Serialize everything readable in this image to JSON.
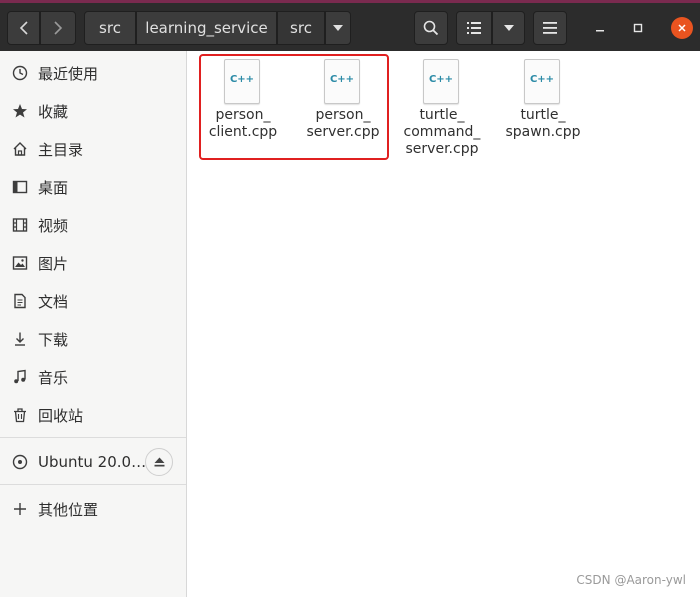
{
  "toolbar": {
    "back_icon": "chevron-left",
    "forward_icon": "chevron-right",
    "breadcrumbs": [
      "src",
      "learning_service",
      "src"
    ],
    "search_icon": "search",
    "view_icon": "list-view",
    "menu_icon": "hamburger"
  },
  "sidebar": {
    "items": [
      {
        "label": "最近使用",
        "icon": "clock"
      },
      {
        "label": "收藏",
        "icon": "star"
      },
      {
        "label": "主目录",
        "icon": "home"
      },
      {
        "label": "桌面",
        "icon": "desktop"
      },
      {
        "label": "视频",
        "icon": "film"
      },
      {
        "label": "图片",
        "icon": "image"
      },
      {
        "label": "文档",
        "icon": "document"
      },
      {
        "label": "下载",
        "icon": "download"
      },
      {
        "label": "音乐",
        "icon": "music"
      },
      {
        "label": "回收站",
        "icon": "trash"
      }
    ],
    "drive": {
      "label": "Ubuntu 20.0…",
      "icon": "disc"
    },
    "other": {
      "label": "其他位置",
      "icon": "plus"
    }
  },
  "files": [
    {
      "name_line1": "person_",
      "name_line2": "client.cpp",
      "name_line3": "",
      "badge": "C++"
    },
    {
      "name_line1": "person_",
      "name_line2": "server.cpp",
      "name_line3": "",
      "badge": "C++"
    },
    {
      "name_line1": "turtle_",
      "name_line2": "command_",
      "name_line3": "server.cpp",
      "badge": "C++"
    },
    {
      "name_line1": "turtle_",
      "name_line2": "spawn.cpp",
      "name_line3": "",
      "badge": "C++"
    }
  ],
  "watermark": "CSDN @Aaron-ywl",
  "colors": {
    "highlight_box": "#e02020",
    "headerbar": "#2c2c2c",
    "accent": "#e95420"
  }
}
